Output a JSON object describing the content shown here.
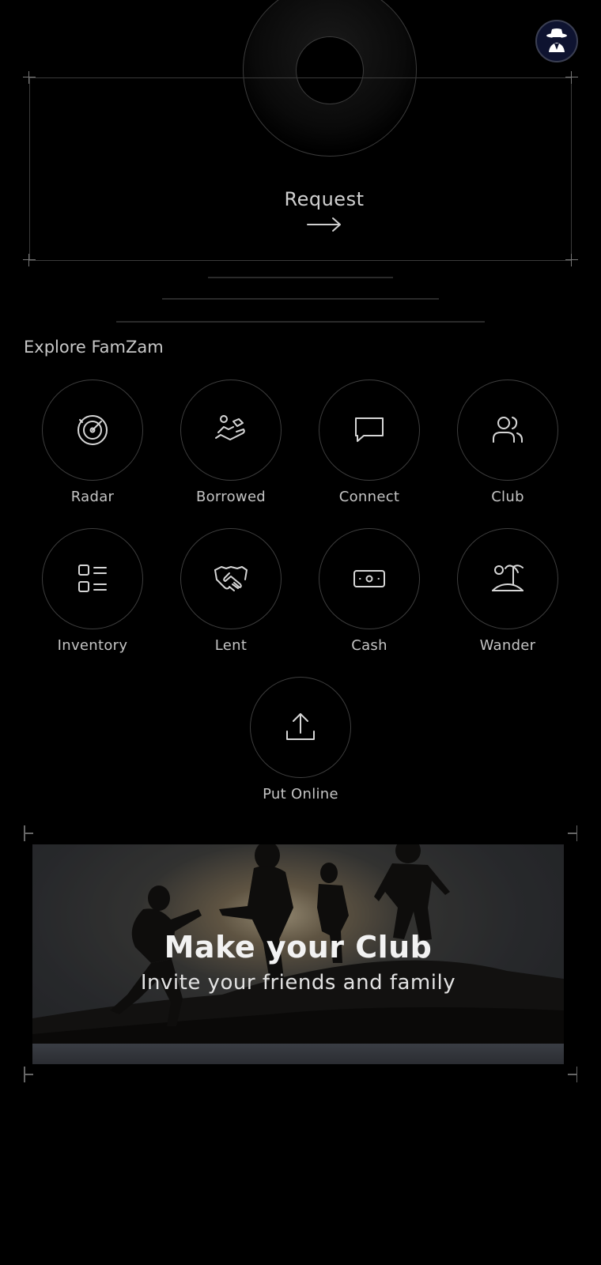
{
  "header": {
    "avatar_icon": "spy-agent-icon"
  },
  "request": {
    "label": "Request",
    "icon": "arrow-right-icon"
  },
  "explore": {
    "title": "Explore FamZam",
    "items": [
      {
        "label": "Radar",
        "icon": "radar-icon"
      },
      {
        "label": "Borrowed",
        "icon": "hand-receive-icon"
      },
      {
        "label": "Connect",
        "icon": "chat-bubble-icon"
      },
      {
        "label": "Club",
        "icon": "users-icon"
      },
      {
        "label": "Inventory",
        "icon": "list-grid-icon"
      },
      {
        "label": "Lent",
        "icon": "handshake-icon"
      },
      {
        "label": "Cash",
        "icon": "banknote-icon"
      },
      {
        "label": "Wander",
        "icon": "island-icon"
      },
      {
        "label": "Put Online",
        "icon": "upload-icon"
      }
    ]
  },
  "banner": {
    "title": "Make your Club",
    "subtitle": "Invite your friends and family"
  }
}
